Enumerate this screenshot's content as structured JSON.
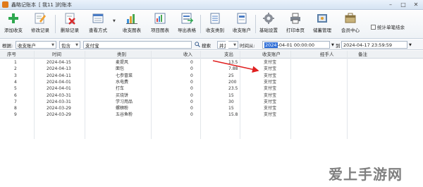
{
  "window": {
    "app_title": "鑫略记账本",
    "doc_title": "[ 我11 ]的账本"
  },
  "toolbar": {
    "buttons": [
      {
        "label": "添加收支",
        "icon": "add-icon"
      },
      {
        "label": "修改记录",
        "icon": "edit-icon"
      },
      {
        "label": "删除记录",
        "icon": "delete-icon"
      },
      {
        "label": "查看方式",
        "icon": "view-icon"
      },
      {
        "label": "收支图表",
        "icon": "chart-icon"
      },
      {
        "label": "项目图表",
        "icon": "project-chart-icon"
      },
      {
        "label": "导出表格",
        "icon": "export-icon"
      },
      {
        "label": "收支类别",
        "icon": "category-icon"
      },
      {
        "label": "收支账户",
        "icon": "account-icon"
      },
      {
        "label": "基础设置",
        "icon": "settings-icon"
      },
      {
        "label": "打印本页",
        "icon": "print-icon"
      },
      {
        "label": "储蓄管理",
        "icon": "savings-icon"
      },
      {
        "label": "会员中心",
        "icon": "member-icon"
      }
    ],
    "stat_checkbox_label": "统计单笔结余"
  },
  "filter": {
    "by_label": "根据:",
    "field_value": "收支账户",
    "op_value": "包含",
    "keyword_value": "支付宝",
    "search_label": "搜索",
    "logic_value": "并且",
    "time_field_value": "时间",
    "time_from_label": "时间从:",
    "date_from": "2024-04-01 00:00:00",
    "date_from_sel": "2024",
    "date_from_rest": "-04-01 00:00:00",
    "to_label": "到",
    "date_to": "2024-04-17 23:59:59"
  },
  "table": {
    "columns": [
      "序号",
      "时间",
      "类别",
      "收入",
      "支出",
      "收支账户",
      "经手人",
      "备注"
    ],
    "rows": [
      [
        "1",
        "2024-04-15",
        "麦提风",
        "0",
        "13.5",
        "支付宝",
        "",
        ""
      ],
      [
        "2",
        "2024-04-13",
        "面包",
        "0",
        "7.88",
        "支付宝",
        "",
        ""
      ],
      [
        "3",
        "2024-04-11",
        "七参冒菜",
        "0",
        "25",
        "支付宝",
        "",
        ""
      ],
      [
        "4",
        "2024-04-01",
        "水电费",
        "0",
        "200",
        "支付宝",
        "",
        ""
      ],
      [
        "5",
        "2024-04-01",
        "打车",
        "0",
        "23.5",
        "支付宝",
        "",
        ""
      ],
      [
        "6",
        "2024-03-31",
        "买烧饼",
        "0",
        "15",
        "支付宝",
        "",
        ""
      ],
      [
        "7",
        "2024-03-31",
        "学习用品",
        "0",
        "30",
        "支付宝",
        "",
        ""
      ],
      [
        "8",
        "2024-03-29",
        "螺蛳粉",
        "0",
        "15",
        "支付宝",
        "",
        ""
      ],
      [
        "9",
        "2024-03-29",
        "五谷鱼粉",
        "0",
        "15.8",
        "支付宝",
        "",
        ""
      ]
    ]
  },
  "watermark": {
    "text": "爱上手游网"
  },
  "colors": {
    "annotation_red": "#e02020",
    "selection_blue": "#2f6fd8"
  }
}
